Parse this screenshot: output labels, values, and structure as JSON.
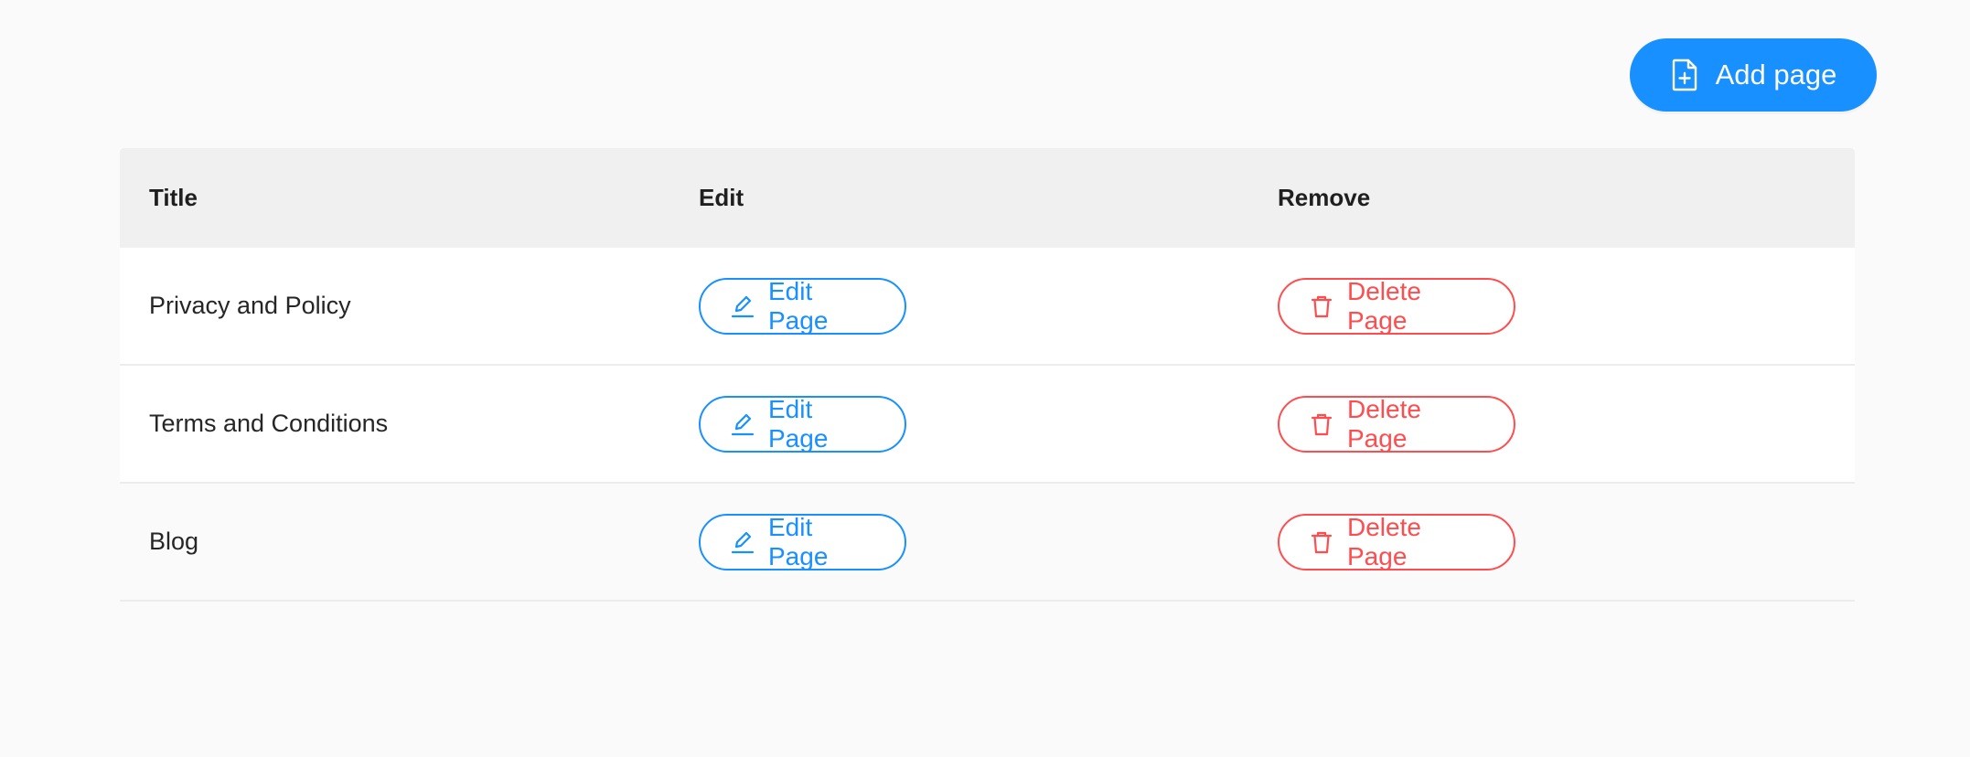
{
  "toolbar": {
    "add_label": "Add page",
    "add_icon": "file-add-icon"
  },
  "table": {
    "columns": [
      "Title",
      "Edit",
      "Remove"
    ],
    "rows": [
      {
        "title": "Privacy and Policy",
        "edit_label": "Edit Page",
        "delete_label": "Delete Page"
      },
      {
        "title": "Terms and Conditions",
        "edit_label": "Edit Page",
        "delete_label": "Delete Page"
      },
      {
        "title": "Blog",
        "edit_label": "Edit Page",
        "delete_label": "Delete Page"
      }
    ]
  },
  "colors": {
    "primary": "#1890ff",
    "danger": "#ff4d4f",
    "header_bg": "#f0f0f0",
    "page_bg": "#fafafa"
  },
  "icons": {
    "edit": "pencil-icon",
    "delete": "trash-icon"
  }
}
